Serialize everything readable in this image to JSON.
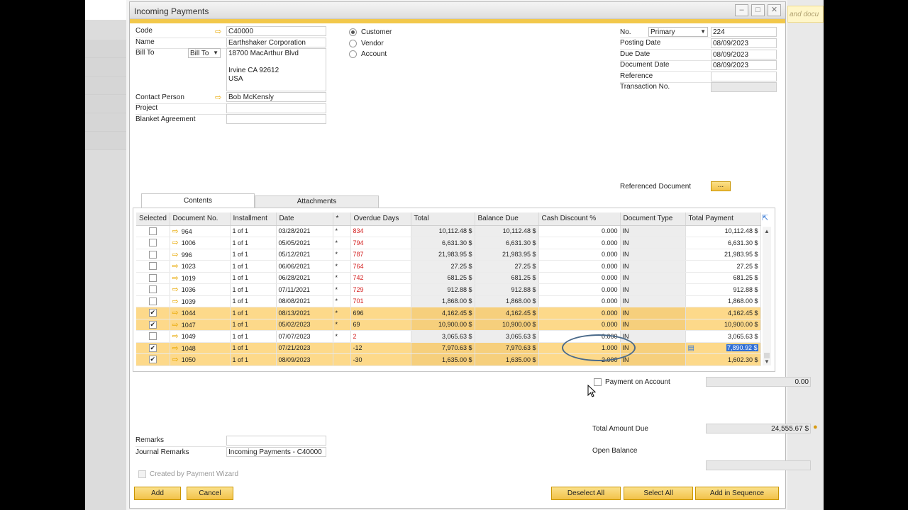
{
  "window": {
    "title": "Incoming Payments"
  },
  "side_hint": "and docu",
  "header": {
    "code_label": "Code",
    "code_value": "C40000",
    "name_label": "Name",
    "name_value": "Earthshaker Corporation",
    "billto_label": "Bill To",
    "billto_select": "Bill To",
    "address": [
      "18700 MacArthur Blvd",
      "",
      "Irvine CA  92612",
      "USA"
    ],
    "contact_label": "Contact Person",
    "contact_value": "Bob McKensly",
    "project_label": "Project",
    "project_value": "",
    "blanket_label": "Blanket Agreement",
    "blanket_value": "",
    "radio_customer": "Customer",
    "radio_vendor": "Vendor",
    "radio_account": "Account",
    "no_label": "No.",
    "no_series": "Primary",
    "no_value": "224",
    "posting_label": "Posting Date",
    "posting_value": "08/09/2023",
    "due_label": "Due Date",
    "due_value": "08/09/2023",
    "docdate_label": "Document Date",
    "docdate_value": "08/09/2023",
    "reference_label": "Reference",
    "reference_value": "",
    "transno_label": "Transaction No.",
    "transno_value": "",
    "refdoc_label": "Referenced Document",
    "refdoc_button": "..."
  },
  "tabs": {
    "contents": "Contents",
    "attachments": "Attachments"
  },
  "table": {
    "columns": [
      "Selected",
      "Document No.",
      "Installment",
      "Date",
      "*",
      "Overdue Days",
      "Total",
      "Balance Due",
      "Cash Discount %",
      "Document Type",
      "Total Payment"
    ],
    "rows": [
      {
        "sel": false,
        "doc": "964",
        "inst": "1 of 1",
        "date": "03/28/2021",
        "star": "*",
        "over": "834",
        "red": true,
        "total": "10,112.48 $",
        "bal": "10,112.48 $",
        "disc": "0.000",
        "type": "IN",
        "pay": "10,112.48 $"
      },
      {
        "sel": false,
        "doc": "1006",
        "inst": "1 of 1",
        "date": "05/05/2021",
        "star": "*",
        "over": "794",
        "red": true,
        "total": "6,631.30 $",
        "bal": "6,631.30 $",
        "disc": "0.000",
        "type": "IN",
        "pay": "6,631.30 $"
      },
      {
        "sel": false,
        "doc": "996",
        "inst": "1 of 1",
        "date": "05/12/2021",
        "star": "*",
        "over": "787",
        "red": true,
        "total": "21,983.95 $",
        "bal": "21,983.95 $",
        "disc": "0.000",
        "type": "IN",
        "pay": "21,983.95 $"
      },
      {
        "sel": false,
        "doc": "1023",
        "inst": "1 of 1",
        "date": "06/06/2021",
        "star": "*",
        "over": "764",
        "red": true,
        "total": "27.25 $",
        "bal": "27.25 $",
        "disc": "0.000",
        "type": "IN",
        "pay": "27.25 $"
      },
      {
        "sel": false,
        "doc": "1019",
        "inst": "1 of 1",
        "date": "06/28/2021",
        "star": "*",
        "over": "742",
        "red": true,
        "total": "681.25 $",
        "bal": "681.25 $",
        "disc": "0.000",
        "type": "IN",
        "pay": "681.25 $"
      },
      {
        "sel": false,
        "doc": "1036",
        "inst": "1 of 1",
        "date": "07/11/2021",
        "star": "*",
        "over": "729",
        "red": true,
        "total": "912.88 $",
        "bal": "912.88 $",
        "disc": "0.000",
        "type": "IN",
        "pay": "912.88 $"
      },
      {
        "sel": false,
        "doc": "1039",
        "inst": "1 of 1",
        "date": "08/08/2021",
        "star": "*",
        "over": "701",
        "red": true,
        "total": "1,868.00 $",
        "bal": "1,868.00 $",
        "disc": "0.000",
        "type": "IN",
        "pay": "1,868.00 $"
      },
      {
        "sel": true,
        "doc": "1044",
        "inst": "1 of 1",
        "date": "08/13/2021",
        "star": "*",
        "over": "696",
        "red": false,
        "total": "4,162.45 $",
        "bal": "4,162.45 $",
        "disc": "0.000",
        "type": "IN",
        "pay": "4,162.45 $"
      },
      {
        "sel": true,
        "doc": "1047",
        "inst": "1 of 1",
        "date": "05/02/2023",
        "star": "*",
        "over": "69",
        "red": false,
        "total": "10,900.00 $",
        "bal": "10,900.00 $",
        "disc": "0.000",
        "type": "IN",
        "pay": "10,900.00 $"
      },
      {
        "sel": false,
        "doc": "1049",
        "inst": "1 of 1",
        "date": "07/07/2023",
        "star": "*",
        "over": "2",
        "red": true,
        "total": "3,065.63 $",
        "bal": "3,065.63 $",
        "disc": "0.000",
        "type": "IN",
        "pay": "3,065.63 $"
      },
      {
        "sel": true,
        "doc": "1048",
        "inst": "1 of 1",
        "date": "07/21/2023",
        "star": "",
        "over": "-12",
        "red": false,
        "total": "7,970.63 $",
        "bal": "7,970.63 $",
        "disc": "1.000",
        "type": "IN",
        "pay": "7,890.92 $",
        "editing": true
      },
      {
        "sel": true,
        "doc": "1050",
        "inst": "1 of 1",
        "date": "08/09/2023",
        "star": "",
        "over": "-30",
        "red": false,
        "total": "1,635.00 $",
        "bal": "1,635.00 $",
        "disc": "2.000",
        "type": "IN",
        "pay": "1,602.30 $"
      }
    ]
  },
  "footer": {
    "poa_label": "Payment on Account",
    "poa_value": "0.00",
    "total_due_label": "Total Amount Due",
    "total_due_value": "24,555.67 $",
    "open_balance_label": "Open Balance",
    "open_balance_value": "",
    "remarks_label": "Remarks",
    "remarks_value": "",
    "journal_label": "Journal Remarks",
    "journal_value": "Incoming Payments - C40000",
    "wizard_label": "Created by Payment Wizard"
  },
  "buttons": {
    "add": "Add",
    "cancel": "Cancel",
    "deselect_all": "Deselect All",
    "select_all": "Select All",
    "add_in_sequence": "Add in Sequence"
  },
  "colors": {
    "accent": "#f2c84b",
    "selected_row": "#fdd98a",
    "overdue": "#d42020"
  },
  "icons": [
    "minimize-icon",
    "maximize-icon",
    "close-icon",
    "link-arrow-icon",
    "expand-icon",
    "calculator-icon",
    "currency-icon",
    "cursor-icon"
  ]
}
